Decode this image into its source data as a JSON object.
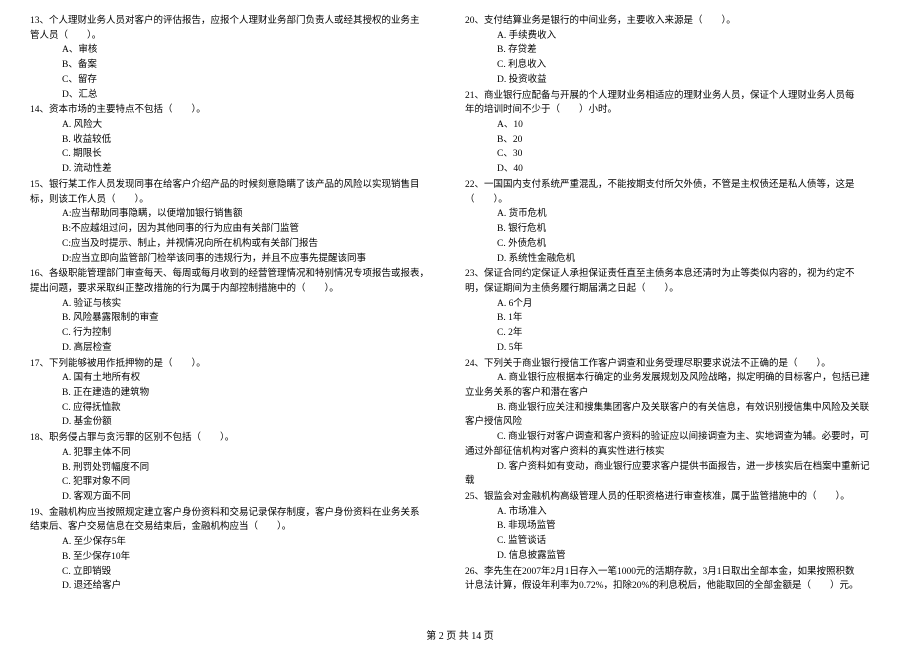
{
  "footer": "第 2 页 共 14 页",
  "left": {
    "q13": {
      "stem": "13、个人理财业务人员对客户的评估报告，应报个人理财业务部门负责人或经其授权的业务主",
      "cont": "管人员（　　）。",
      "opts": [
        "A、审核",
        "B、备案",
        "C、留存",
        "D、汇总"
      ]
    },
    "q14": {
      "stem": "14、资本市场的主要特点不包括（　　）。",
      "opts": [
        "A. 风险大",
        "B. 收益较低",
        "C. 期限长",
        "D. 流动性差"
      ]
    },
    "q15": {
      "stem": "15、银行某工作人员发现同事在给客户介绍产品的时候刻意隐瞒了该产品的风险以实现销售目",
      "cont": "标，则该工作人员（　　）。",
      "opts": [
        "A:应当帮助同事隐瞒，以便增加银行销售额",
        "B:不应越俎过问，因为其他同事的行为应由有关部门监管",
        "C:应当及时提示、制止，并视情况向所在机构或有关部门报告",
        "D:应当立即向监管部门检举该同事的违规行为，并且不应事先提醒该同事"
      ]
    },
    "q16": {
      "stem": "16、各级职能管理部门审查每天、每周或每月收到的经营管理情况和特别情况专项报告或报表，",
      "cont": "提出问题，要求采取纠正整改措施的行为属于内部控制措施中的（　　）。",
      "opts": [
        "A. 验证与核实",
        "B. 风险暴露限制的审查",
        "C. 行为控制",
        "D. 高层检查"
      ]
    },
    "q17": {
      "stem": "17、下列能够被用作抵押物的是（　　）。",
      "opts": [
        "A. 国有土地所有权",
        "B. 正在建造的建筑物",
        "C. 应得抚恤款",
        "D. 基金份额"
      ]
    },
    "q18": {
      "stem": "18、职务侵占罪与贪污罪的区别不包括（　　）。",
      "opts": [
        "A. 犯罪主体不同",
        "B. 刑罚处罚幅度不同",
        "C. 犯罪对象不同",
        "D. 客观方面不同"
      ]
    },
    "q19": {
      "stem": "19、金融机构应当按照规定建立客户身份资料和交易记录保存制度，客户身份资料在业务关系",
      "cont": "结束后、客户交易信息在交易结束后，金融机构应当（　　）。",
      "opts": [
        "A. 至少保存5年",
        "B. 至少保存10年",
        "C. 立即销毁",
        "D. 退还给客户"
      ]
    }
  },
  "right": {
    "q20": {
      "stem": "20、支付结算业务是银行的中间业务，主要收入来源是（　　）。",
      "opts": [
        "A. 手续费收入",
        "B. 存贷差",
        "C. 利息收入",
        "D. 投资收益"
      ]
    },
    "q21": {
      "stem": "21、商业银行应配备与开展的个人理财业务相适应的理财业务人员，保证个人理财业务人员每",
      "cont": "年的培训时间不少于（　　）小时。",
      "opts": [
        "A、10",
        "B、20",
        "C、30",
        "D、40"
      ]
    },
    "q22": {
      "stem": "22、一国国内支付系统严重混乱，不能按期支付所欠外债，不管是主权债还是私人债等，这是",
      "cont": "（　　）。",
      "opts": [
        "A. 货币危机",
        "B. 银行危机",
        "C. 外债危机",
        "D. 系统性金融危机"
      ]
    },
    "q23": {
      "stem": "23、保证合同约定保证人承担保证责任直至主债务本息还清时为止等类似内容的，视为约定不",
      "cont": "明，保证期间为主债务履行期届满之日起（　　）。",
      "opts": [
        "A. 6个月",
        "B. 1年",
        "C. 2年",
        "D. 5年"
      ]
    },
    "q24": {
      "stem": "24、下列关于商业银行授信工作客户调查和业务受理尽职要求说法不正确的是（　　）。",
      "optA": "A. 商业银行应根据本行确定的业务发展规划及风险战略，拟定明确的目标客户，包括已建",
      "optAcont": "立业务关系的客户和潜在客户",
      "optB": "B. 商业银行应关注和搜集集团客户及关联客户的有关信息，有效识别授信集中风险及关联",
      "optBcont": "客户授信风险",
      "optC": "C. 商业银行对客户调查和客户资料的验证应以间接调查为主、实地调查为辅。必要时，可",
      "optCcont": "通过外部征信机构对客户资料的真实性进行核实",
      "optD": "D. 客户资料如有变动，商业银行应要求客户提供书面报告，进一步核实后在档案中重新记",
      "optDcont": "载"
    },
    "q25": {
      "stem": "25、银监会对金融机构高级管理人员的任职资格进行审查核准，属于监管措施中的（　　）。",
      "opts": [
        "A. 市场准入",
        "B. 非现场监管",
        "C. 监管谈话",
        "D. 信息披露监管"
      ]
    },
    "q26": {
      "stem": "26、李先生在2007年2月1日存入一笔1000元的活期存款，3月1日取出全部本金，如果按照积数",
      "cont": "计息法计算，假设年利率为0.72%，扣除20%的利息税后，他能取回的全部金额是（　　）元。"
    }
  }
}
